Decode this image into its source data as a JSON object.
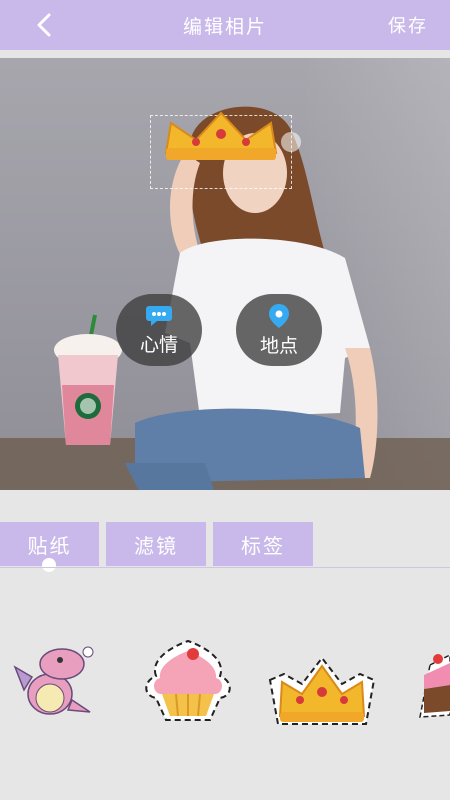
{
  "header": {
    "title": "编辑相片",
    "save_label": "保存"
  },
  "photo_tags": {
    "mood": {
      "label": "心情"
    },
    "location": {
      "label": "地点"
    }
  },
  "tabs": [
    {
      "label": "贴纸",
      "active": true
    },
    {
      "label": "滤镜",
      "active": false
    },
    {
      "label": "标签",
      "active": false
    }
  ],
  "stickers": [
    {
      "name": "dragon"
    },
    {
      "name": "cupcake"
    },
    {
      "name": "crown"
    },
    {
      "name": "cake-slice"
    }
  ],
  "colors": {
    "accent": "#c9b9ea",
    "panel": "#e6e6e6",
    "pill_icon": "#35aaf0"
  }
}
